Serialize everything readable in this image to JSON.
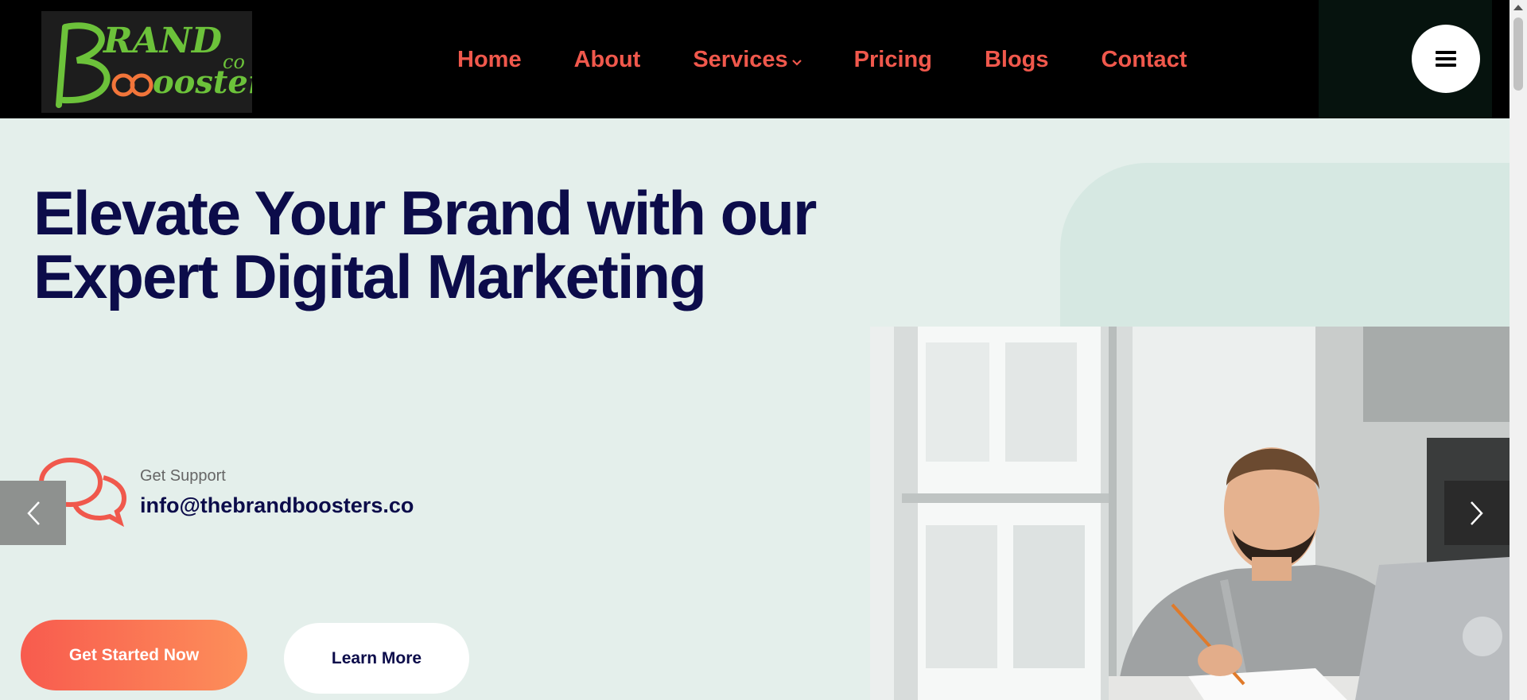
{
  "header": {
    "logo_text_top": "RAND",
    "logo_text_bottom": "oosters",
    "logo_suffix": "co",
    "nav": [
      {
        "label": "Home"
      },
      {
        "label": "About"
      },
      {
        "label": "Services"
      },
      {
        "label": "Pricing"
      },
      {
        "label": "Blogs"
      },
      {
        "label": "Contact"
      }
    ]
  },
  "hero": {
    "title_line1": "Elevate Your Brand with our",
    "title_line2": "Expert Digital Marketing",
    "support_label": "Get Support",
    "support_email": "info@thebrandboosters.co",
    "cta_primary": "Get Started Now",
    "cta_secondary": "Learn More"
  },
  "icons": {
    "menu": "hamburger-icon",
    "support": "chat-bubbles-icon",
    "prev": "chevron-left-icon",
    "next": "chevron-right-icon",
    "dropdown": "chevron-down-icon"
  },
  "colors": {
    "header_bg": "#000000",
    "nav_text": "#f0584c",
    "page_bg": "#e4efeb",
    "title": "#0c0c4a",
    "accent": "#f85b4e",
    "logo_green": "#6cc23a",
    "logo_orange": "#f2753a"
  }
}
